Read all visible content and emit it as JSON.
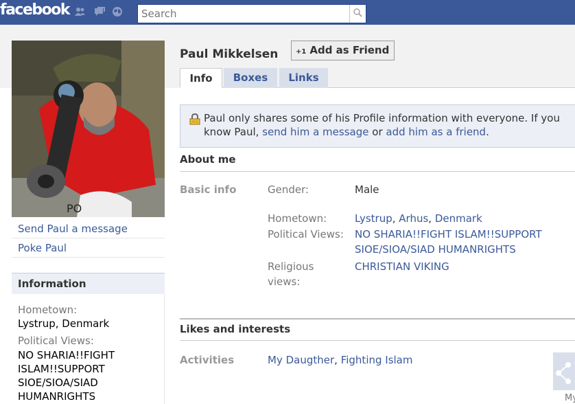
{
  "topbar": {
    "logo": "facebook",
    "search_placeholder": "Search"
  },
  "profile": {
    "name": "Paul Mikkelsen",
    "add_friend_label": "Add as Friend",
    "add_friend_prefix": "+1"
  },
  "tabs": [
    {
      "label": "Info",
      "active": true
    },
    {
      "label": "Boxes",
      "active": false
    },
    {
      "label": "Links",
      "active": false
    }
  ],
  "left_links": {
    "send_message": "Send Paul a message",
    "poke": "Poke Paul"
  },
  "information_box": {
    "title": "Information",
    "hometown_label": "Hometown:",
    "hometown_value": "Lystrup, Denmark",
    "political_label": "Political Views:",
    "political_value": "NO SHARIA!!FIGHT ISLAM!!SUPPORT SIOE/SIOA/SIAD HUMANRIGHTS"
  },
  "notice": {
    "text_before": "Paul only shares some of his Profile information with everyone. If you know Paul,",
    "link1": "send him a message",
    "text_mid": "or",
    "link2": "add him as a friend",
    "text_end": "."
  },
  "about": {
    "title": "About me",
    "basic_info_label": "Basic info",
    "gender_label": "Gender:",
    "gender_value": "Male",
    "hometown_label": "Hometown:",
    "hometown_parts": [
      "Lystrup",
      "Arhus",
      "Denmark"
    ],
    "political_label": "Political Views:",
    "political_value_line1": "NO SHARIA!!FIGHT ISLAM!!SUPPORT",
    "political_value_line2": "SIOE/SIOA/SIAD HUMANRIGHTS",
    "religious_label_line1": "Religious",
    "religious_label_line2": "views:",
    "religious_value": "CHRISTIAN VIKING"
  },
  "likes": {
    "title": "Likes and interests",
    "activities_label": "Activities",
    "activity1": "My Daugther",
    "activity2": "Fighting Islam"
  },
  "side_widget": {
    "label": "My"
  },
  "photo_text": "PO",
  "colors": {
    "brand_blue": "#3b5998",
    "tab_inactive_bg": "#d8dfea",
    "notice_bg": "#eceff5"
  }
}
